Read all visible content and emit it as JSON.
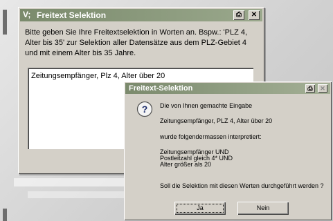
{
  "back_window": {
    "title": "Freitext Selektion",
    "icon": "app-v-icon",
    "description": "Bitte geben Sie Ihre Freitextselektion in Worten an. Bspw.: 'PLZ 4, Alter bis 35' zur Selektion aller Datensätze aus dem PLZ-Gebiet 4 und mit einem Alter bis 35 Jahre.",
    "input_value": "Zeitungsempfänger, Plz 4, Alter über 20"
  },
  "dialog": {
    "title": "Freitext-Selektion",
    "icon": "question-icon",
    "line1": "Die von Ihnen gemachte Eingabe",
    "line2": "Zeitungsempfänger, PLZ 4, Alter über 20",
    "line3": "wurde folgendermassen interpretiert:",
    "interp1": "Zeitungsempfänger UND",
    "interp2": "Postleitzahl gleich 4* UND",
    "interp3": "Alter größer als 20",
    "question": "Soll die Selektion mit diesen Werten durchgeführt werden ?",
    "yes_label": "Ja",
    "no_label": "Nein"
  },
  "colors": {
    "titlebar": "#7a8a6c",
    "dialog_face": "#d4d0c8"
  }
}
